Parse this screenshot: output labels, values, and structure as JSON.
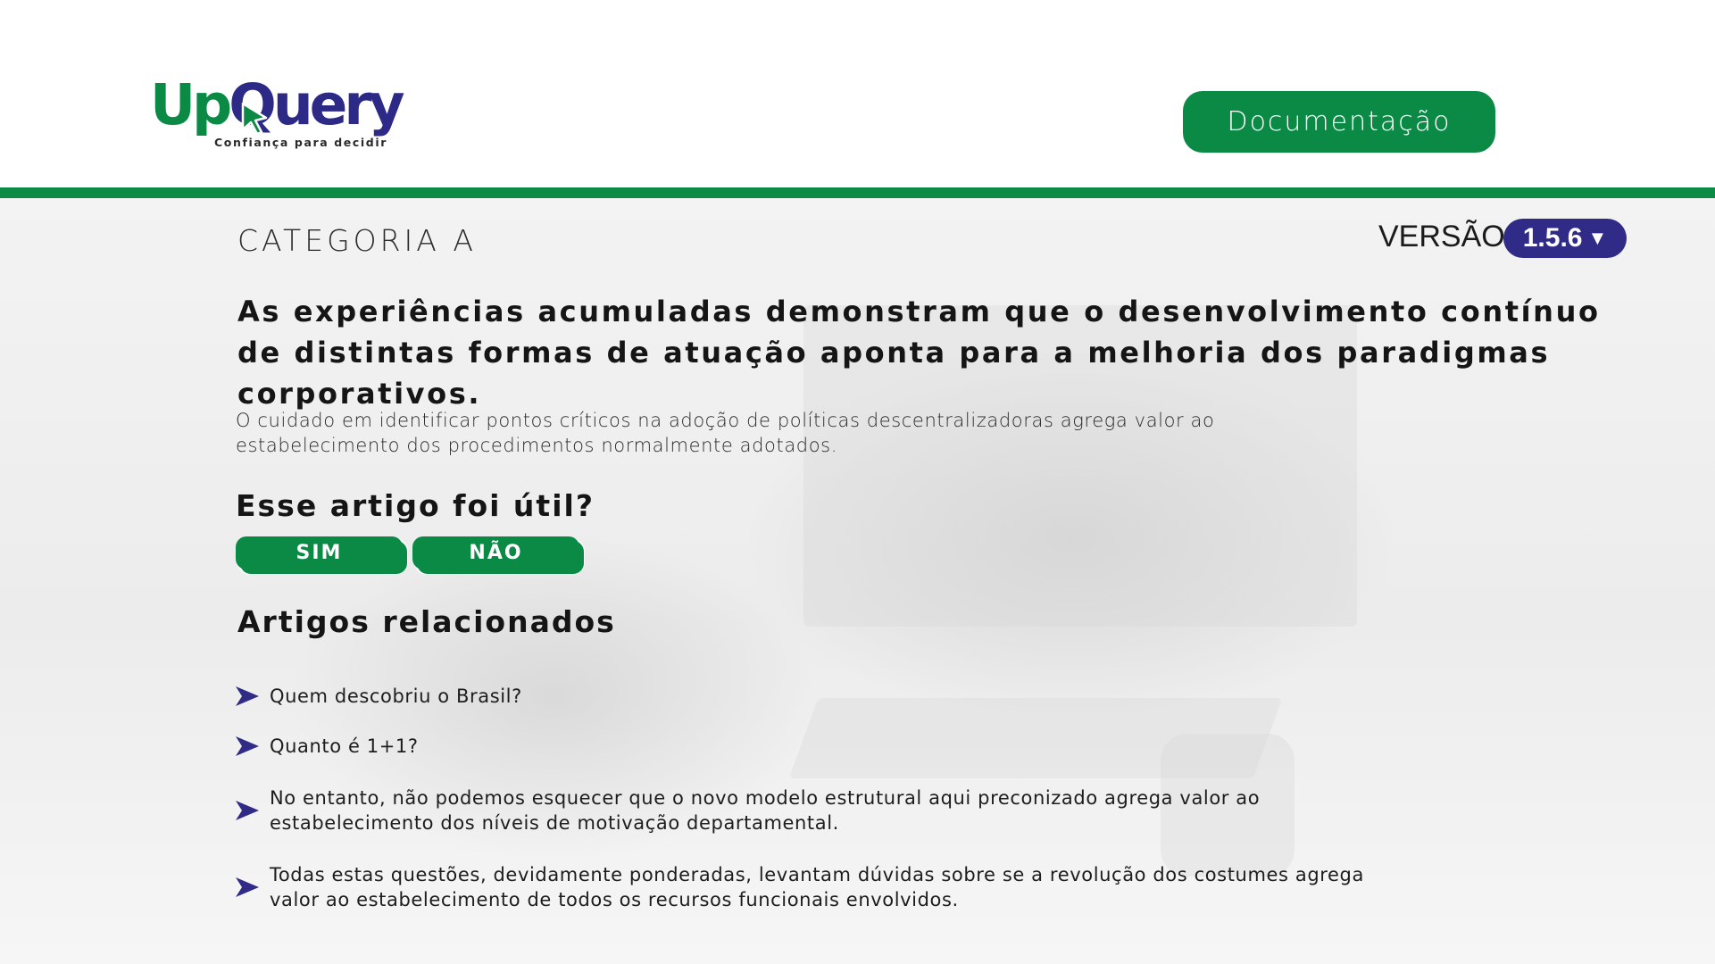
{
  "header": {
    "logo": {
      "brand_up": "Up",
      "brand_rest": "Query",
      "tagline": "Confiança para decidir"
    },
    "doc_button_label": "Documentação"
  },
  "article": {
    "category": "CATEGORIA A",
    "version_label": "VERSÃO",
    "version_value": "1.5.6",
    "headline": "As experiências acumuladas demonstram que o desenvolvimento contínuo de distintas formas de atuação aponta para a melhoria dos paradigmas corporativos.",
    "body": "O cuidado em identificar pontos críticos na adoção de políticas descentralizadoras agrega valor ao estabelecimento dos procedimentos normalmente adotados."
  },
  "feedback": {
    "question": "Esse artigo foi útil?",
    "yes_label": "SIM",
    "no_label": "NÃO"
  },
  "related": {
    "title": "Artigos relacionados",
    "items": [
      {
        "text": "Quem descobriu o Brasil?"
      },
      {
        "text": "Quanto é 1+1?"
      },
      {
        "text": "No entanto, não podemos esquecer que o novo modelo estrutural aqui preconizado agrega valor ao estabelecimento dos níveis de motivação departamental."
      },
      {
        "text": "Todas estas questões, devidamente ponderadas, levantam dúvidas sobre se a revolução dos costumes agrega valor ao estabelecimento de todos os recursos funcionais envolvidos."
      }
    ]
  },
  "colors": {
    "brand_green": "#0a8a45",
    "brand_purple": "#2f2b86"
  },
  "icons": {
    "related_item": "play-arrow-icon",
    "version_caret": "caret-down-icon"
  }
}
